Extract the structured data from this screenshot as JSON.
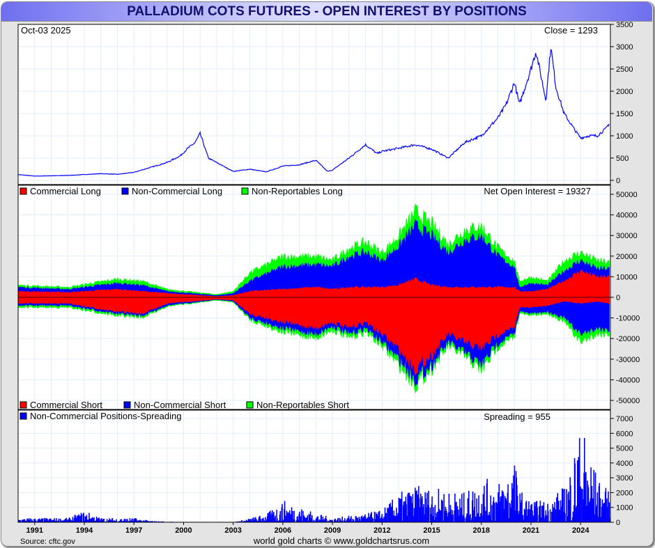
{
  "title": "PALLADIUM COTS FUTURES - OPEN INTEREST BY POSITIONS",
  "date_label": "Oct-03  2025",
  "close_label": "Close = 1293",
  "net_oi_label": "Net Open Interest = 19327",
  "spreading_label": "Spreading = 955",
  "source": "Source: cftc.gov",
  "credit": "world gold charts © www.goldchartsrus.com",
  "legend_long": [
    "Commercial Long",
    "Non-Commercial Long",
    "Non-Reportables Long"
  ],
  "legend_short": [
    "Commercial Short",
    "Non-Commercial Short",
    "Non-Reportables Short"
  ],
  "legend_spread": "Non-Commercial Positions-Spreading",
  "colors": {
    "commercial": "#ff0000",
    "noncommercial": "#0000ff",
    "nonreportable": "#00ff00",
    "price": "#0000ff"
  },
  "chart_data": [
    {
      "type": "line",
      "name": "price",
      "xlim": [
        1990,
        2025.8
      ],
      "ylim": [
        0,
        3500
      ],
      "yticks": [
        0,
        500,
        1000,
        1500,
        2000,
        2500,
        3000,
        3500
      ],
      "x": [
        1990,
        1991,
        1993,
        1995,
        1996,
        1997,
        1998,
        1999,
        1999.8,
        2000.2,
        2000.7,
        2001,
        2001.5,
        2002,
        2003,
        2004,
        2005,
        2006,
        2007,
        2008,
        2008.7,
        2009,
        2010,
        2011,
        2011.7,
        2012,
        2013,
        2014,
        2015,
        2016,
        2017,
        2018,
        2019,
        2019.5,
        2020,
        2020.3,
        2021,
        2021.3,
        2021.9,
        2022.2,
        2022.5,
        2023,
        2023.7,
        2024,
        2024.5,
        2025,
        2025.5,
        2025.75
      ],
      "y": [
        130,
        95,
        110,
        150,
        135,
        180,
        290,
        400,
        550,
        700,
        850,
        1050,
        500,
        400,
        200,
        250,
        190,
        320,
        350,
        450,
        200,
        230,
        500,
        800,
        600,
        650,
        720,
        800,
        700,
        500,
        850,
        1000,
        1400,
        1700,
        2200,
        1700,
        2500,
        2900,
        1800,
        3000,
        2100,
        1500,
        1100,
        950,
        1000,
        1000,
        1150,
        1293
      ]
    },
    {
      "type": "area",
      "name": "positions",
      "ylim": [
        -50000,
        50000
      ],
      "yticks": [
        -50000,
        -40000,
        -30000,
        -20000,
        -10000,
        0,
        10000,
        20000,
        30000,
        40000,
        50000
      ],
      "x": [
        1990,
        1993,
        1996,
        1997.5,
        1999,
        2002,
        2003,
        2004,
        2006,
        2008,
        2009,
        2010,
        2011,
        2012,
        2013,
        2014,
        2015,
        2016,
        2017,
        2018,
        2019,
        2020,
        2020.3,
        2021,
        2022,
        2023,
        2024,
        2025,
        2025.75
      ],
      "series": [
        {
          "name": "Commercial Long",
          "values": [
            3000,
            2500,
            4000,
            3000,
            2000,
            500,
            1000,
            3000,
            4000,
            5000,
            4000,
            5000,
            5000,
            5000,
            6000,
            9000,
            6000,
            5000,
            5000,
            5000,
            5000,
            5000,
            3000,
            3000,
            4000,
            8000,
            13000,
            10000,
            10000
          ]
        },
        {
          "name": "Non-Commercial Long",
          "values": [
            2000,
            1500,
            3000,
            3000,
            1000,
            500,
            1000,
            5000,
            11000,
            11000,
            11000,
            15000,
            17000,
            13000,
            19000,
            26000,
            24000,
            17000,
            23000,
            25000,
            15000,
            10000,
            2000,
            4000,
            2000,
            5000,
            5000,
            4000,
            4000
          ]
        },
        {
          "name": "Non-Reportables Long",
          "values": [
            1000,
            1000,
            2000,
            2000,
            1000,
            500,
            1000,
            4000,
            5000,
            4000,
            3000,
            4000,
            5000,
            4000,
            5000,
            7000,
            6000,
            4000,
            5000,
            5000,
            4000,
            3000,
            3000,
            3000,
            2000,
            5000,
            4000,
            4000,
            3000
          ]
        },
        {
          "name": "Commercial Short",
          "values": [
            3000,
            3000,
            7000,
            8000,
            3000,
            1000,
            1500,
            8000,
            12000,
            15000,
            12000,
            15000,
            12000,
            18000,
            25000,
            35000,
            28000,
            18000,
            22000,
            25000,
            18000,
            15000,
            5000,
            5000,
            4000,
            2000,
            3000,
            2000,
            3000
          ]
        },
        {
          "name": "Non-Commercial Short",
          "values": [
            1000,
            1000,
            1000,
            1000,
            1000,
            200,
            500,
            2000,
            3000,
            3000,
            2000,
            3000,
            3000,
            4000,
            5000,
            5000,
            5000,
            4000,
            5000,
            8000,
            4000,
            3000,
            2000,
            3000,
            3000,
            8000,
            15000,
            13000,
            13000
          ]
        },
        {
          "name": "Non-Reportables Short",
          "values": [
            1000,
            1000,
            1000,
            1000,
            500,
            300,
            500,
            1000,
            2000,
            2000,
            2000,
            2000,
            2000,
            2000,
            3000,
            3000,
            2000,
            2000,
            2000,
            3000,
            2000,
            2000,
            1000,
            1000,
            1000,
            2000,
            4000,
            3000,
            2000
          ]
        }
      ]
    },
    {
      "type": "bar",
      "name": "spreading",
      "ylim": [
        0,
        7000
      ],
      "yticks": [
        0,
        1000,
        2000,
        3000,
        4000,
        5000,
        6000,
        7000
      ],
      "x": [
        1990,
        1993,
        1994,
        1995,
        1997,
        1998,
        2000,
        2003,
        2004,
        2005,
        2006,
        2008,
        2009,
        2011,
        2012,
        2013,
        2014,
        2016,
        2017,
        2018,
        2019,
        2020,
        2020.3,
        2021,
        2022,
        2023,
        2023.8,
        2024.2,
        2025,
        2025.75
      ],
      "envelope": [
        300,
        300,
        800,
        300,
        300,
        100,
        0,
        0,
        300,
        600,
        1500,
        600,
        300,
        600,
        900,
        2000,
        2500,
        2200,
        2000,
        3000,
        2800,
        4200,
        2200,
        1500,
        1500,
        2500,
        6000,
        6200,
        3000,
        2000
      ]
    },
    {
      "type": "axis",
      "xticks": [
        "1991",
        "1994",
        "1997",
        "2000",
        "2003",
        "2006",
        "2009",
        "2012",
        "2015",
        "2018",
        "2021",
        "2024"
      ]
    }
  ]
}
